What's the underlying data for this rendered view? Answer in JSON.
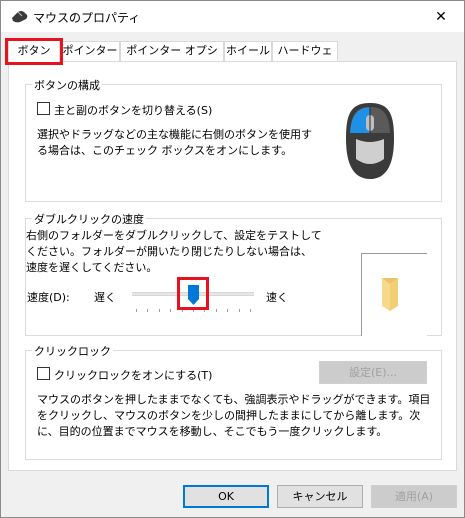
{
  "window": {
    "title": "マウスのプロパティ",
    "close_label": "✕"
  },
  "tabs": [
    {
      "label": "ボタン",
      "active": true
    },
    {
      "label": "ポインター",
      "active": false
    },
    {
      "label": "ポインター オプション",
      "active": false
    },
    {
      "label": "ホイール",
      "active": false
    },
    {
      "label": "ハードウェア",
      "active": false
    }
  ],
  "button_config": {
    "group_title": "ボタンの構成",
    "swap_checkbox_label": "主と副のボタンを切り替える(S)",
    "swap_checked": false,
    "description": "選択やドラッグなどの主な機能に右側のボタンを使用する場合は、このチェック ボックスをオンにします。"
  },
  "double_click": {
    "group_title": "ダブルクリックの速度",
    "description": "右側のフォルダーをダブルクリックして、設定をテストしてください。フォルダーが開いたり閉じたりしない場合は、速度を遅くしてください。",
    "speed_label": "速度(D):",
    "slow_label": "遅く",
    "fast_label": "速く",
    "speed_value": 0.5,
    "tick_count": 11
  },
  "click_lock": {
    "group_title": "クリックロック",
    "checkbox_label": "クリックロックをオンにする(T)",
    "checked": false,
    "settings_button": "設定(E)...",
    "description": "マウスのボタンを押したままでなくても、強調表示やドラッグができます。項目をクリックし、マウスのボタンを少しの間押したままにしてから離します。次に、目的の位置までマウスを移動し、そこでもう一度クリックします。"
  },
  "footer": {
    "ok": "OK",
    "cancel": "キャンセル",
    "apply": "適用(A)"
  },
  "colors": {
    "highlight": "#e8111e",
    "accent": "#0078d7",
    "mouse_button_highlight": "#1e90e6"
  }
}
